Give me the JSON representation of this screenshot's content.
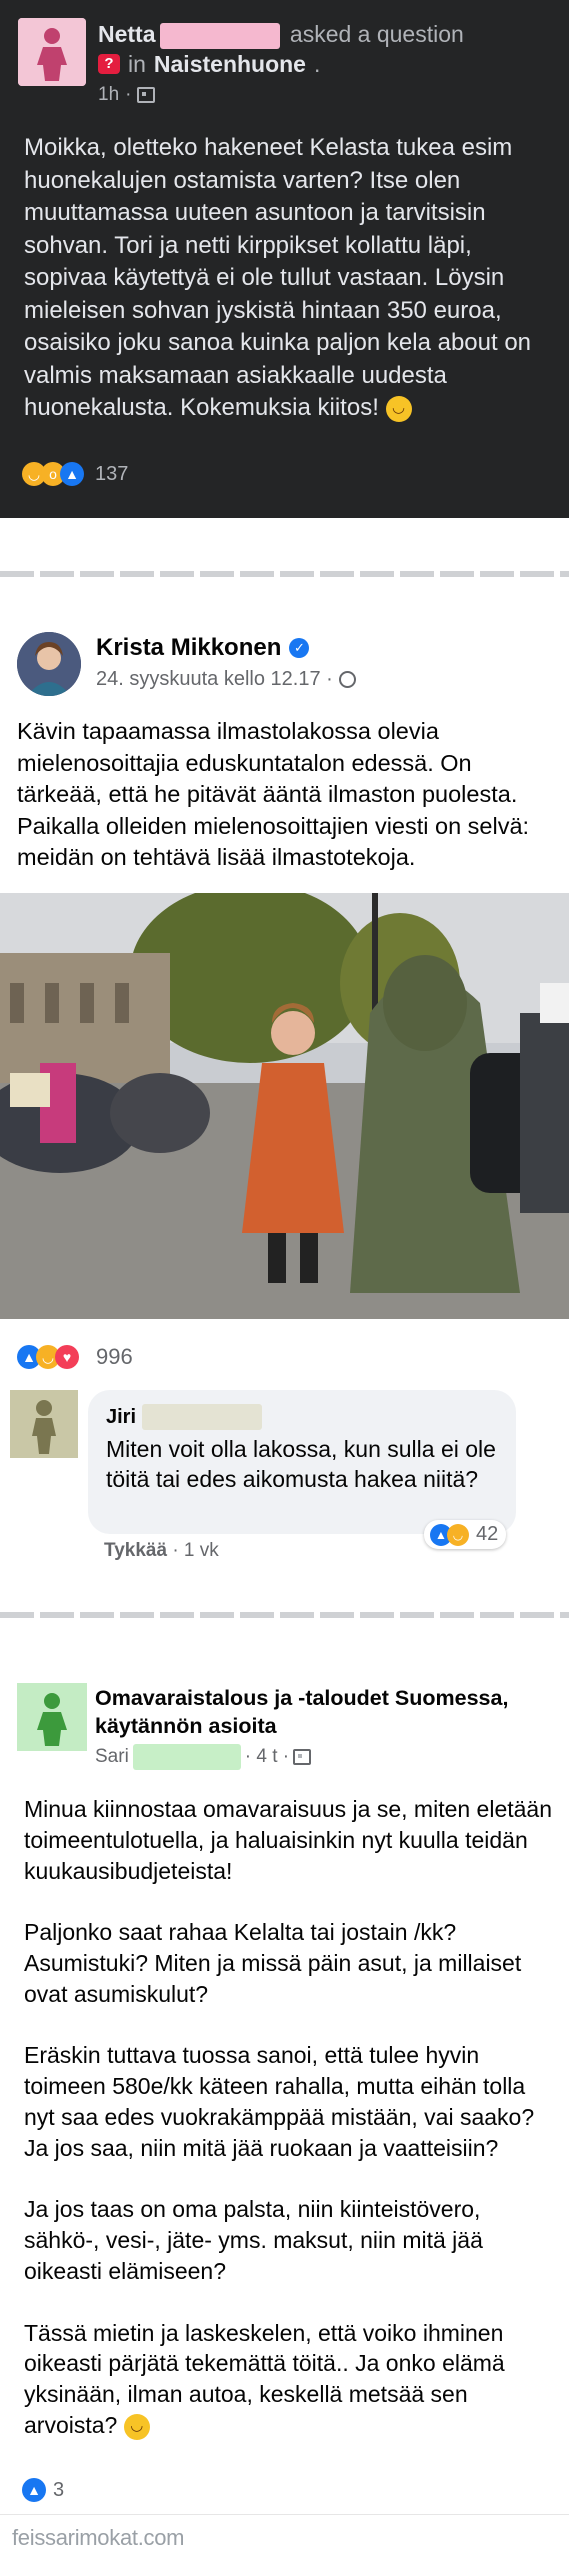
{
  "post1": {
    "author": "Netta",
    "action": "asked a question",
    "in_word": "in",
    "group": "Naistenhuone",
    "time": "1h",
    "body": "Moikka, oletteko hakeneet Kelasta tukea esim huonekalujen ostamista varten? Itse olen muuttamassa uuteen asuntoon ja tarvitsisin sohvan. Tori ja netti kirppikset kollattu läpi, sopivaa käytettyä ei ole tullut vastaan. Löysin mieleisen sohvan jyskistä hintaan 350 euroa, osaisiko joku sanoa kuinka paljon kela about on valmis maksamaan asiakkaalle uudesta huonekalusta. Kokemuksia kiitos!",
    "reaction_count": "137",
    "avatar_color": "#f3c6d6"
  },
  "post2": {
    "author": "Krista Mikkonen",
    "date": "24. syyskuuta kello 12.17 ·",
    "body": "Kävin tapaamassa ilmastolakossa olevia mielenosoittajia eduskuntatalon edessä. On tärkeää, että he pitävät ääntä ilmaston puolesta. Paikalla olleiden mielenosoittajien viesti on selvä: meidän on tehtävä lisää ilmastotekoja.",
    "reaction_count": "996",
    "comment": {
      "author": "Jiri",
      "text": "Miten voit olla lakossa, kun sulla ei ole töitä tai edes aikomusta hakea niitä?",
      "reaction_count": "42",
      "like_label": "Tykkää",
      "age": "· 1 vk"
    }
  },
  "post3": {
    "group": "Omavaraistalous ja -taloudet Suomessa, käytännön asioita",
    "author": "Sari",
    "time": "· 4 t ·",
    "paragraphs": [
      "Minua kiinnostaa omavaraisuus ja se, miten eletään toimeentulotuella, ja haluaisinkin nyt kuulla teidän kuukausibudjeteista!",
      "Paljonko saat rahaa Kelalta tai jostain /kk? Asumistuki? Miten ja missä päin asut, ja millaiset ovat asumiskulut?",
      "Eräskin tuttava tuossa sanoi, että tulee hyvin toimeen 580e/kk käteen rahalla, mutta eihän tolla nyt saa edes vuokrakämppää mistään, vai saako? Ja jos saa, niin mitä jää ruokaan ja vaatteisiin?",
      "Ja jos taas on oma palsta, niin kiinteistövero, sähkö-, vesi-, jäte- yms. maksut, niin mitä jää oikeasti elämiseen?",
      "Tässä mietin ja laskeskelen, että voiko ihminen oikeasti pärjätä tekemättä töitä.. Ja onko elämä yksinään, ilman autoa, keskellä metsää sen arvoista?"
    ],
    "reaction_count": "3"
  },
  "footer": {
    "watermark": "feissarimokat.com"
  },
  "colors": {
    "dark_bg": "#242526",
    "fb_blue": "#1877f2",
    "love_red": "#f33e58",
    "haha_yellow": "#f7b125"
  },
  "icons": [
    "person-silhouette-icon",
    "question-badge-icon",
    "privacy-icon",
    "verified-badge-icon",
    "globe-icon",
    "like-reaction-icon",
    "haha-reaction-icon",
    "wow-reaction-icon",
    "love-reaction-icon"
  ]
}
